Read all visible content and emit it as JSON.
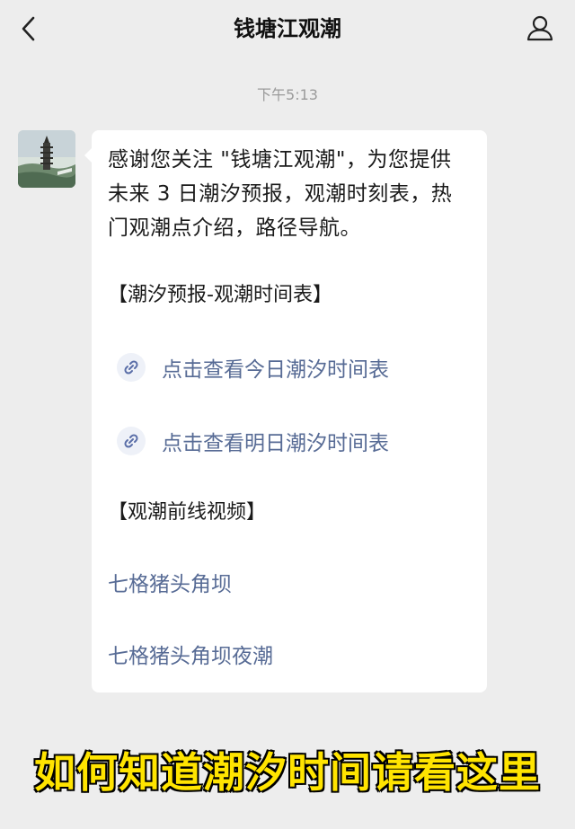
{
  "header": {
    "title": "钱塘江观潮",
    "back_icon": "chevron-left-icon",
    "profile_icon": "person-icon"
  },
  "chat": {
    "timestamp": "下午5:13",
    "message": {
      "intro": "感谢您关注 \"钱塘江观潮\"，为您提供未来 3 日潮汐预报，观潮时刻表，热门观潮点介绍，路径导航。",
      "section_forecast": "【潮汐预报-观潮时间表】",
      "links": [
        {
          "label": "点击查看今日潮汐时间表",
          "icon": "mini-program-link-icon"
        },
        {
          "label": "点击查看明日潮汐时间表",
          "icon": "mini-program-link-icon"
        }
      ],
      "section_videos": "【观潮前线视频】",
      "videos": [
        {
          "label": "七格猪头角坝"
        },
        {
          "label": "七格猪头角坝夜潮"
        }
      ]
    }
  },
  "caption": "如何知道潮汐时间请看这里",
  "colors": {
    "background": "#ededed",
    "bubble": "#ffffff",
    "link": "#576b95",
    "caption_fill": "#ffe400"
  }
}
